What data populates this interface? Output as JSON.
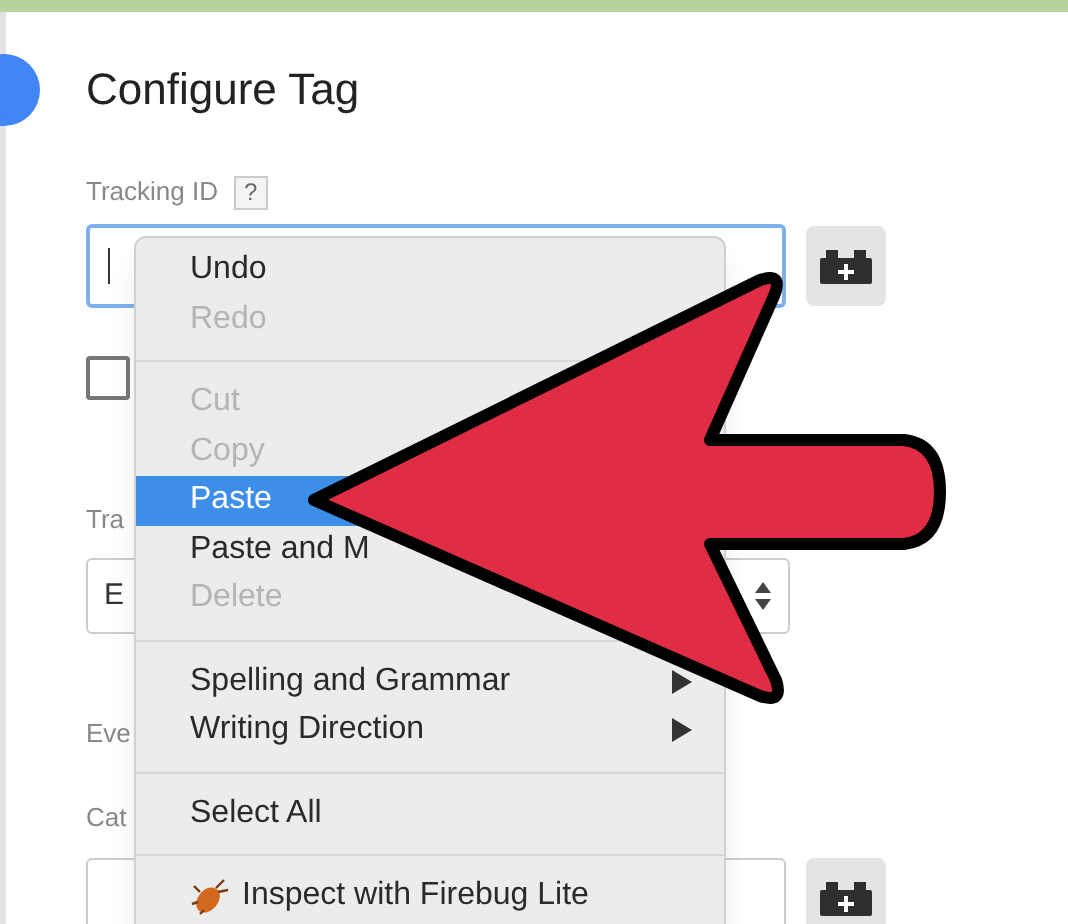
{
  "section": {
    "title": "Configure Tag"
  },
  "tracking_id": {
    "label": "Tracking ID",
    "help": "?"
  },
  "checkbox": {
    "checked": false
  },
  "field_3": {
    "label": "Tra",
    "value": "E"
  },
  "field_4": {
    "label": "Eve"
  },
  "field_5": {
    "label": "Cat"
  },
  "context_menu": [
    {
      "kind": "item",
      "label": "Undo",
      "disabled": false,
      "selected": false
    },
    {
      "kind": "item",
      "label": "Redo",
      "disabled": true,
      "selected": false
    },
    {
      "kind": "separator"
    },
    {
      "kind": "item",
      "label": "Cut",
      "disabled": true,
      "selected": false
    },
    {
      "kind": "item",
      "label": "Copy",
      "disabled": true,
      "selected": false
    },
    {
      "kind": "item",
      "label": "Paste",
      "disabled": false,
      "selected": true
    },
    {
      "kind": "item",
      "label": "Paste and M",
      "disabled": false,
      "selected": false
    },
    {
      "kind": "item",
      "label": "Delete",
      "disabled": true,
      "selected": false
    },
    {
      "kind": "separator"
    },
    {
      "kind": "submenu",
      "label": "Spelling and Grammar",
      "disabled": false,
      "selected": false
    },
    {
      "kind": "submenu",
      "label": "Writing Direction",
      "disabled": false,
      "selected": false
    },
    {
      "kind": "separator"
    },
    {
      "kind": "item",
      "label": "Select All",
      "disabled": false,
      "selected": false
    },
    {
      "kind": "separator"
    },
    {
      "kind": "extension",
      "label": "Inspect with Firebug Lite",
      "disabled": false,
      "selected": false
    }
  ]
}
